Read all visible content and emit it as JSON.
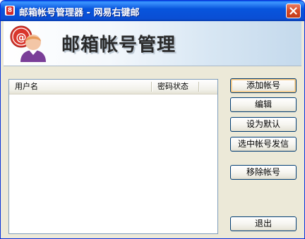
{
  "window": {
    "title": "邮箱帐号管理器 - 网易右键邮",
    "app_icon_letter": "8",
    "close_icon": "close-icon"
  },
  "header": {
    "title": "邮箱帐号管理",
    "avatar_icon": "user-email-avatar-icon"
  },
  "account_list": {
    "columns": [
      "用户名",
      "密码状态"
    ],
    "rows": []
  },
  "buttons": {
    "add": "添加帐号",
    "edit": "编辑",
    "set_default": "设为默认",
    "send_mail": "选中帐号发信",
    "remove": "移除帐号",
    "exit": "退出"
  },
  "colors": {
    "titlebar": "#0855dd",
    "close_button": "#d64a26",
    "button_border": "#003c74",
    "focus_highlight": "#f0c27a"
  }
}
